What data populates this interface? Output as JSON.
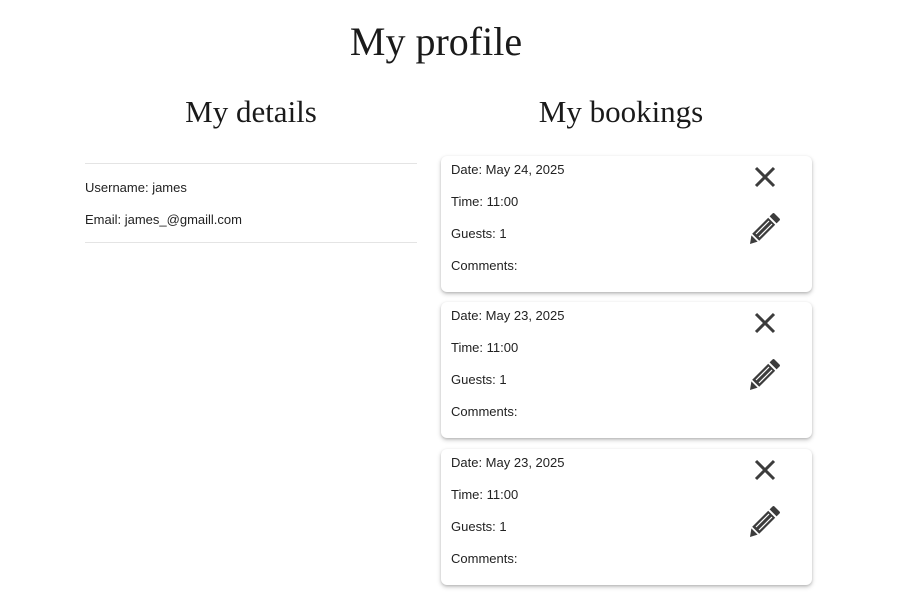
{
  "page": {
    "title": "My profile"
  },
  "details": {
    "title": "My details",
    "username_label": "Username: james",
    "email_label": "Email: james_@gmaill.com"
  },
  "bookings": {
    "title": "My bookings",
    "items": [
      {
        "date": "Date: May 24, 2025",
        "time": "Time: 11:00",
        "guests": "Guests: 1",
        "comments": "Comments:",
        "cancel_icon": "close-icon",
        "edit_icon": "pencil-icon"
      },
      {
        "date": "Date: May 23, 2025",
        "time": "Time: 11:00",
        "guests": "Guests: 1",
        "comments": "Comments:",
        "cancel_icon": "close-icon",
        "edit_icon": "pencil-icon"
      },
      {
        "date": "Date: May 23, 2025",
        "time": "Time: 11:00",
        "guests": "Guests: 1",
        "comments": "Comments:",
        "cancel_icon": "close-icon",
        "edit_icon": "pencil-icon"
      }
    ]
  },
  "colors": {
    "icon": "#3c3c3c",
    "divider": "#e4e4e4",
    "text": "#222222"
  }
}
